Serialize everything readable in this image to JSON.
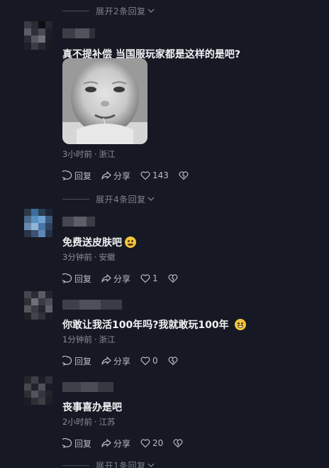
{
  "expand_top": {
    "label": "展开2条回复"
  },
  "comments": [
    {
      "text": "真不提补偿 当国服玩家都是这样的是吧?",
      "time": "3小时前",
      "location": "浙江",
      "reply_label": "回复",
      "share_label": "分享",
      "likes": "143",
      "has_image": true
    },
    {
      "text": "免费送皮肤吧",
      "emoji": "thinking-emoji",
      "time": "3分钟前",
      "location": "安徽",
      "reply_label": "回复",
      "share_label": "分享",
      "likes": "1"
    },
    {
      "text": "你敢让我活100年吗?我就敢玩100年",
      "emoji": "grin-emoji",
      "time": "1分钟前",
      "location": "浙江",
      "reply_label": "回复",
      "share_label": "分享",
      "likes": "0"
    },
    {
      "text": "丧事喜办是吧",
      "time": "2小时前",
      "location": "江苏",
      "reply_label": "回复",
      "share_label": "分享",
      "likes": "20"
    }
  ],
  "expand_mid": {
    "label": "展开4条回复"
  },
  "expand_bottom": {
    "label": "展开1条回复"
  },
  "colors": {
    "background": "#161823",
    "text": "#f1f2f4",
    "muted": "#8c8e97"
  },
  "icons": {
    "reply": "comment-bubble-icon",
    "share": "share-arrow-icon",
    "like": "heart-icon",
    "dislike": "broken-heart-icon"
  }
}
